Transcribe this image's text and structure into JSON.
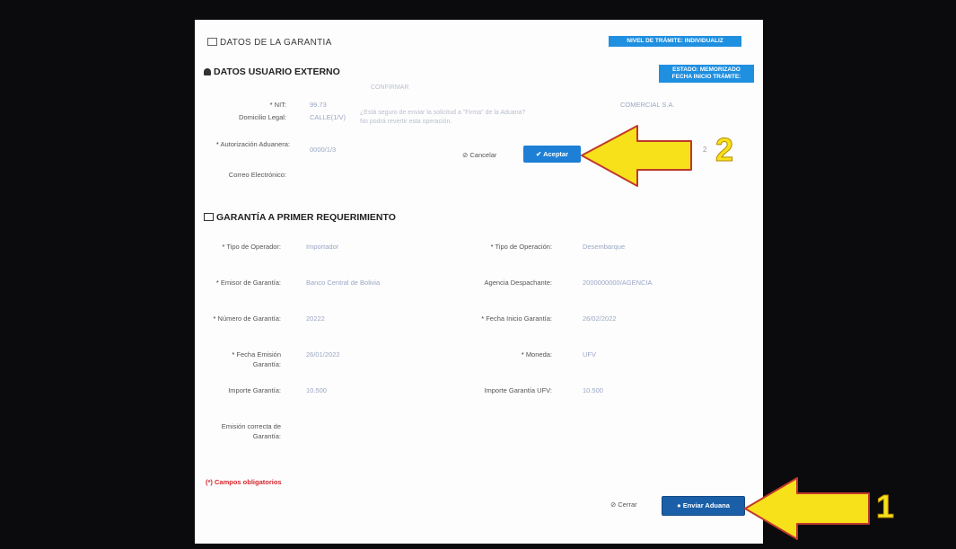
{
  "header": {
    "title": "DATOS DE LA GARANTIA",
    "nivel_badge": "NIVEL DE TRÁMITE: INDIVIDUALIZ"
  },
  "usuario": {
    "title": "DATOS USUARIO EXTERNO",
    "estado_badge_line1": "ESTADO: MEMORIZADO",
    "estado_badge_line2": "FECHA INICIO TRÁMITE:",
    "hint_top": "CONFIRMAR",
    "fields": {
      "nit_label": "NIT:",
      "nit_value": "99.73",
      "domicilio_label": "Domicilio Legal:",
      "domicilio_value": "CALLE(1/V)",
      "autorizacion_label": "Autorización Aduanera:",
      "autorizacion_value": "0000/1/3",
      "correo_label": "Correo Electrónico:",
      "right_value": "COMERCIAL S.A."
    },
    "confirm_message_line1": "¿Está seguro de enviar la solicitud a \"Firma\" de la Aduana?",
    "confirm_message_line2": "No podrá revertir esta operación.",
    "cancel_label": "Cancelar",
    "accept_label": "Aceptar",
    "side_char": "2"
  },
  "garantia": {
    "title": "GARANTÍA A PRIMER REQUERIMIENTO",
    "left": [
      {
        "label": "Tipo de Operador:",
        "value": "Importador",
        "required": true
      },
      {
        "label": "Emisor de Garantía:",
        "value": "Banco Central de Bolivia",
        "required": true
      },
      {
        "label": "Número de Garantía:",
        "value": "20222",
        "required": true
      },
      {
        "label": "Fecha Emisión Garantía:",
        "value": "26/01/2022",
        "required": true
      },
      {
        "label": "Importe Garantía:",
        "value": "10.500",
        "required": false
      },
      {
        "label": "Emisión correcta de Garantía:",
        "value": "",
        "required": false
      }
    ],
    "right": [
      {
        "label": "Tipo de Operación:",
        "value": "Desembarque",
        "required": true
      },
      {
        "label": "Agencia Despachante:",
        "value": "2000000000/AGENCIA",
        "required": false
      },
      {
        "label": "Fecha Inicio Garantía:",
        "value": "26/02/2022",
        "required": true
      },
      {
        "label": "Moneda:",
        "value": "UFV",
        "required": true
      },
      {
        "label": "Importe Garantía UFV:",
        "value": "10.500",
        "required": false
      }
    ]
  },
  "footer": {
    "required_note": "(*) Campos obligatorios",
    "close_label": "Cerrar",
    "send_label": "Enviar Aduana"
  },
  "annotations": {
    "arrow1_number": "1",
    "arrow2_number": "2",
    "arrow_color": "#f6e11a"
  }
}
